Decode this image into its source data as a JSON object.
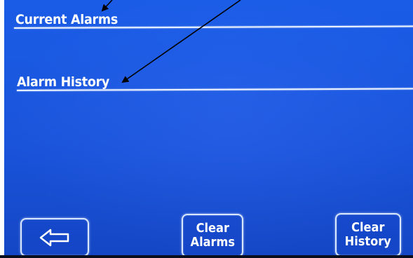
{
  "sections": {
    "current_alarms_title": "Current Alarms",
    "alarm_history_title": "Alarm History"
  },
  "buttons": {
    "back_icon": "back-arrow-icon",
    "clear_alarms_label": "Clear\nAlarms",
    "clear_history_label": "Clear\nHistory"
  },
  "colors": {
    "screen_background": "#1a54db",
    "text": "#ffffff",
    "rule": "#eaf2ff",
    "annotation_arrow": "#000000"
  }
}
